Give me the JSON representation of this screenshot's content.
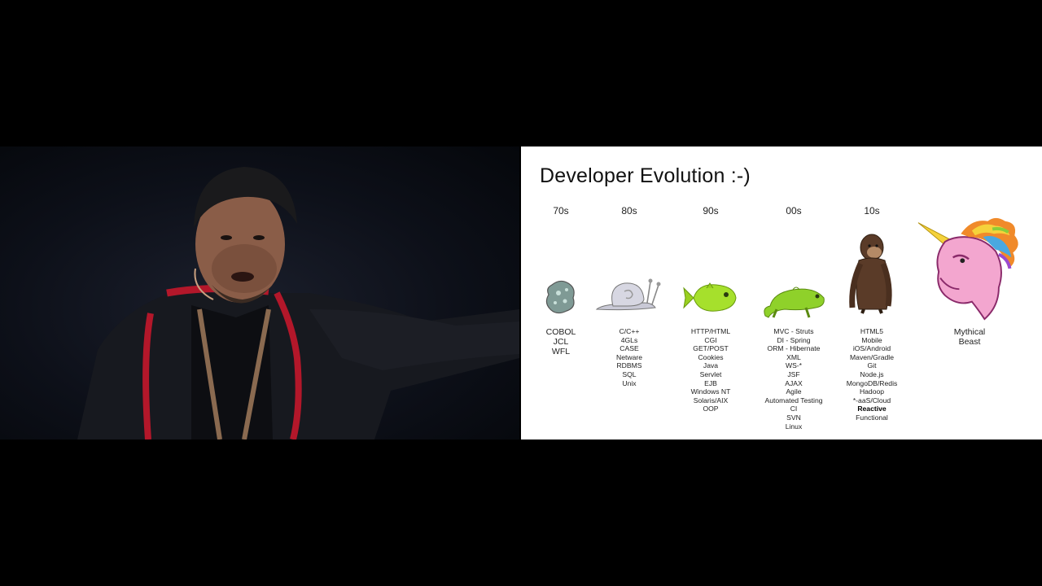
{
  "slide": {
    "title": "Developer Evolution :-)",
    "eras": [
      {
        "decade": "70s",
        "creature": "amoeba-icon",
        "items": [
          "COBOL",
          "JCL",
          "WFL"
        ]
      },
      {
        "decade": "80s",
        "creature": "snail-icon",
        "items": [
          "C/C++",
          "4GLs",
          "CASE",
          "Netware",
          "RDBMS",
          "SQL",
          "Unix"
        ]
      },
      {
        "decade": "90s",
        "creature": "fish-icon",
        "items": [
          "HTTP/HTML",
          "CGI",
          "GET/POST",
          "Cookies",
          "Java",
          "Servlet",
          "EJB",
          "Windows NT",
          "Solaris/AIX",
          "OOP"
        ]
      },
      {
        "decade": "00s",
        "creature": "lizard-icon",
        "items": [
          "MVC - Struts",
          "DI - Spring",
          "ORM - Hibernate",
          "XML",
          "WS-*",
          "JSF",
          "AJAX",
          "Agile",
          "Automated Testing",
          "CI",
          "SVN",
          "Linux"
        ]
      },
      {
        "decade": "10s",
        "creature": "ape-icon",
        "items": [
          "HTML5",
          "Mobile",
          "iOS/Android",
          "Maven/Gradle",
          "Git",
          "Node.js",
          "MongoDB/Redis",
          "Hadoop",
          "*-aaS/Cloud",
          "Reactive",
          "Functional"
        ],
        "bold_item": "Reactive"
      },
      {
        "decade": "",
        "creature": "unicorn-icon",
        "items": [
          "Mythical",
          "Beast"
        ]
      }
    ]
  },
  "colors": {
    "slide_background": "#ffffff",
    "speaker_background": "#0d1019",
    "hoodie_trim": "#c0182a"
  }
}
